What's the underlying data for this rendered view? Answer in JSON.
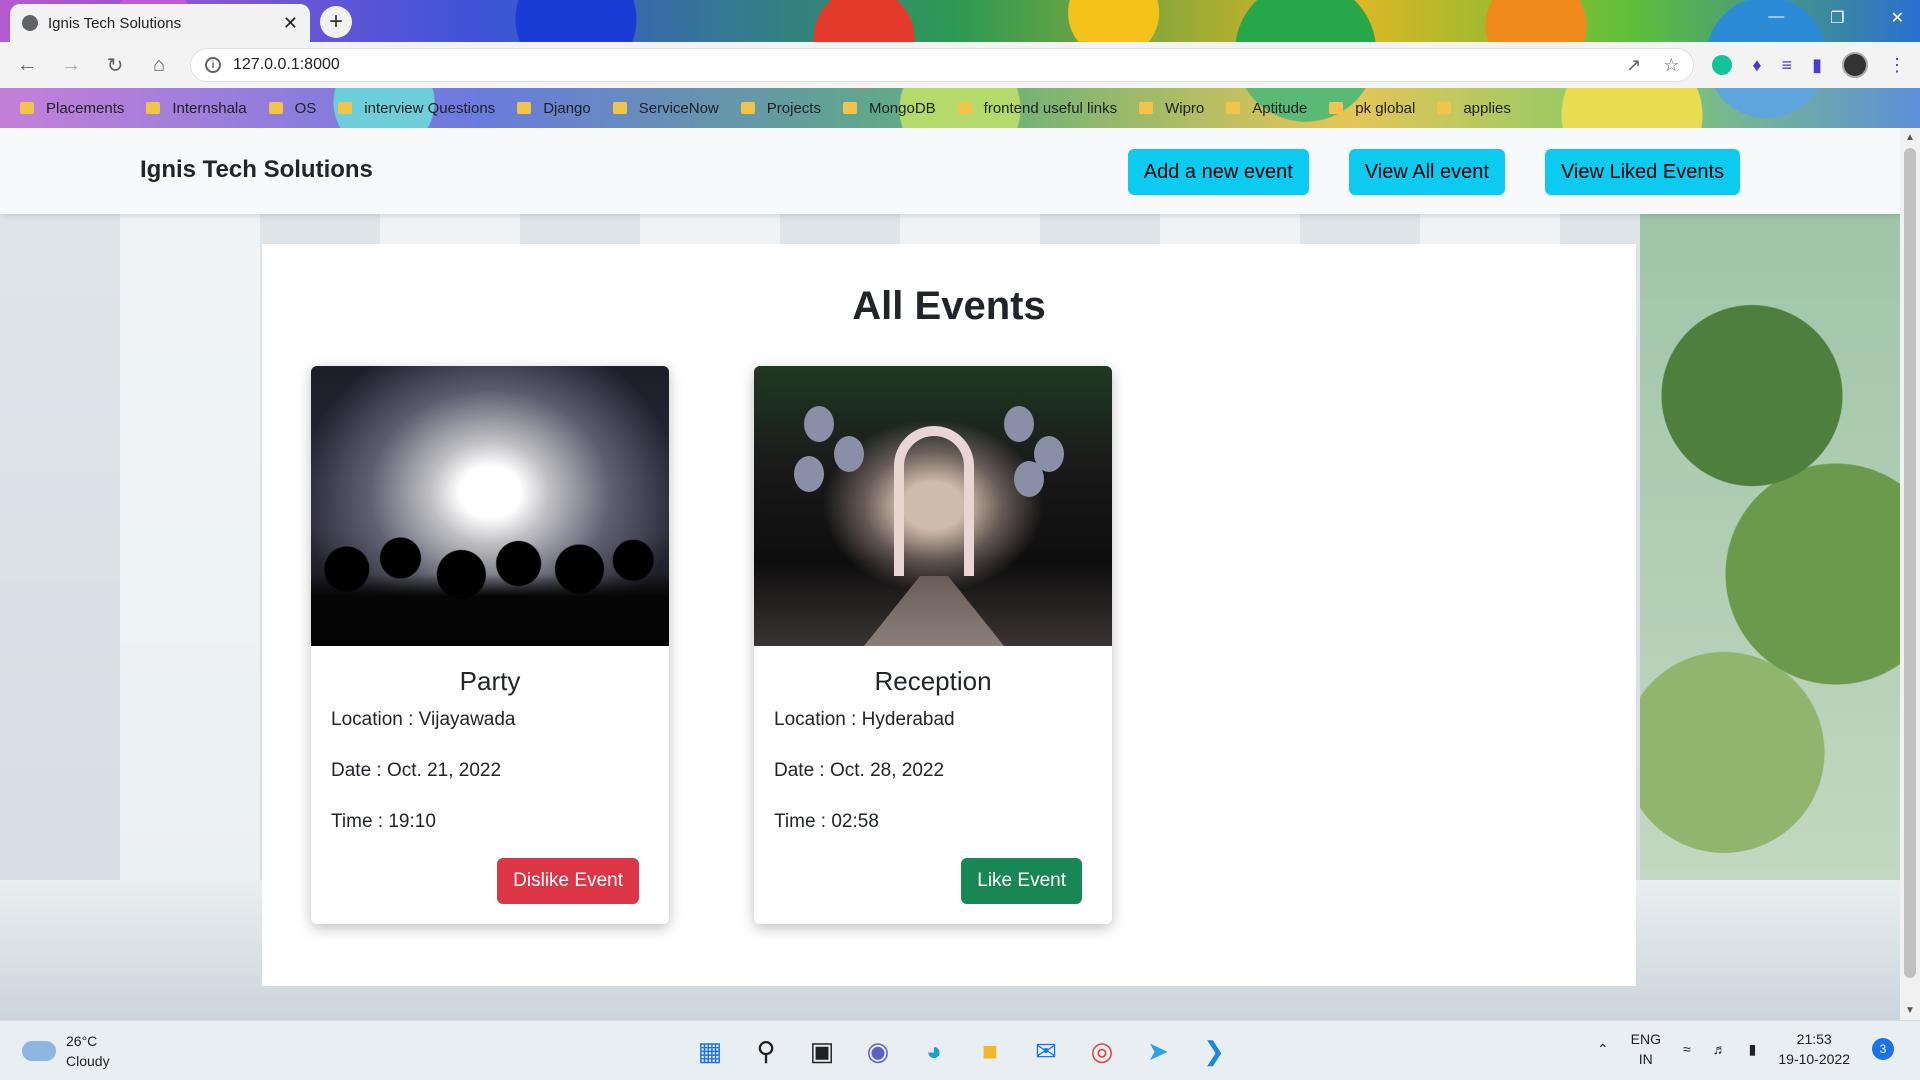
{
  "browser": {
    "tab_title": "Ignis Tech Solutions",
    "tab_close": "✕",
    "new_tab": "+",
    "url": "127.0.0.1:8000",
    "bookmarks": [
      "Placements",
      "Internshala",
      "OS",
      "interview Questions",
      "Django",
      "ServiceNow",
      "Projects",
      "MongoDB",
      "frontend useful links",
      "Wipro",
      "Aptitude",
      "pk global",
      "applies"
    ]
  },
  "navbar": {
    "brand": "Ignis Tech Solutions",
    "buttons": [
      "Add a new event",
      "View All event",
      "View Liked Events"
    ]
  },
  "main": {
    "title": "All Events",
    "events": [
      {
        "name": "Party",
        "location": "Location : Vijayawada",
        "date": "Date : Oct. 21, 2022",
        "time": "Time : 19:10",
        "action": "Dislike Event",
        "action_color": "#dc3545"
      },
      {
        "name": "Reception",
        "location": "Location : Hyderabad",
        "date": "Date : Oct. 28, 2022",
        "time": "Time : 02:58",
        "action": "Like Event",
        "action_color": "#198754"
      }
    ]
  },
  "taskbar": {
    "temperature": "26°C",
    "weather": "Cloudy",
    "language": "ENG",
    "region": "IN",
    "time": "21:53",
    "date": "19-10-2022",
    "notifications": "3"
  },
  "colors": {
    "nav_button": "#0dcaf0",
    "navbar_bg": "#f8f9fa"
  }
}
